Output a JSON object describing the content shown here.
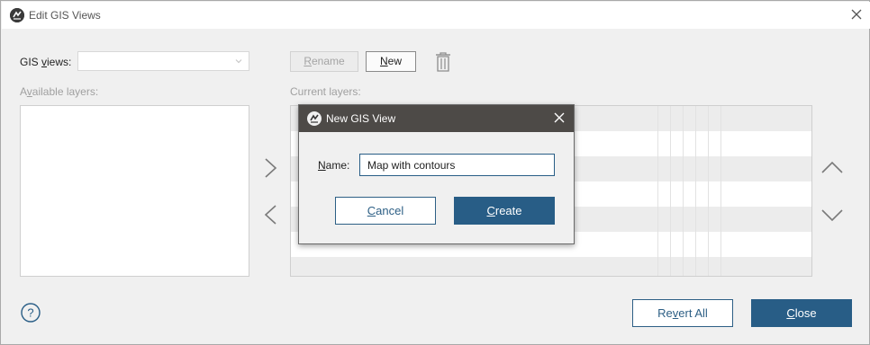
{
  "window": {
    "title": "Edit GIS Views",
    "close_icon": "close-icon"
  },
  "gis_views": {
    "label_prefix": "GIS ",
    "label_mnemonic": "v",
    "label_suffix": "iews:",
    "selected_value": ""
  },
  "toolbar": {
    "rename_prefix": "",
    "rename_mnemonic": "R",
    "rename_suffix": "ename",
    "new_prefix": "",
    "new_mnemonic": "N",
    "new_suffix": "ew",
    "delete_icon": "trash-icon"
  },
  "available_layers": {
    "label_prefix": "A",
    "label_mnemonic": "v",
    "label_suffix": "ailable layers:",
    "items": []
  },
  "current_layers": {
    "label": "Current layers:",
    "items": []
  },
  "footer": {
    "help_icon": "help-icon",
    "revert_prefix": "Re",
    "revert_mnemonic": "v",
    "revert_suffix": "ert All",
    "close_prefix": "",
    "close_mnemonic": "C",
    "close_suffix": "lose"
  },
  "modal": {
    "title": "New GIS View",
    "name_prefix": "",
    "name_mnemonic": "N",
    "name_suffix": "ame:",
    "name_value": "Map with contours",
    "cancel_prefix": "",
    "cancel_mnemonic": "C",
    "cancel_suffix": "ancel",
    "create_prefix": "",
    "create_mnemonic": "C",
    "create_suffix": "reate"
  },
  "colors": {
    "accent": "#285d86",
    "modal_titlebar": "#4d4a47"
  }
}
